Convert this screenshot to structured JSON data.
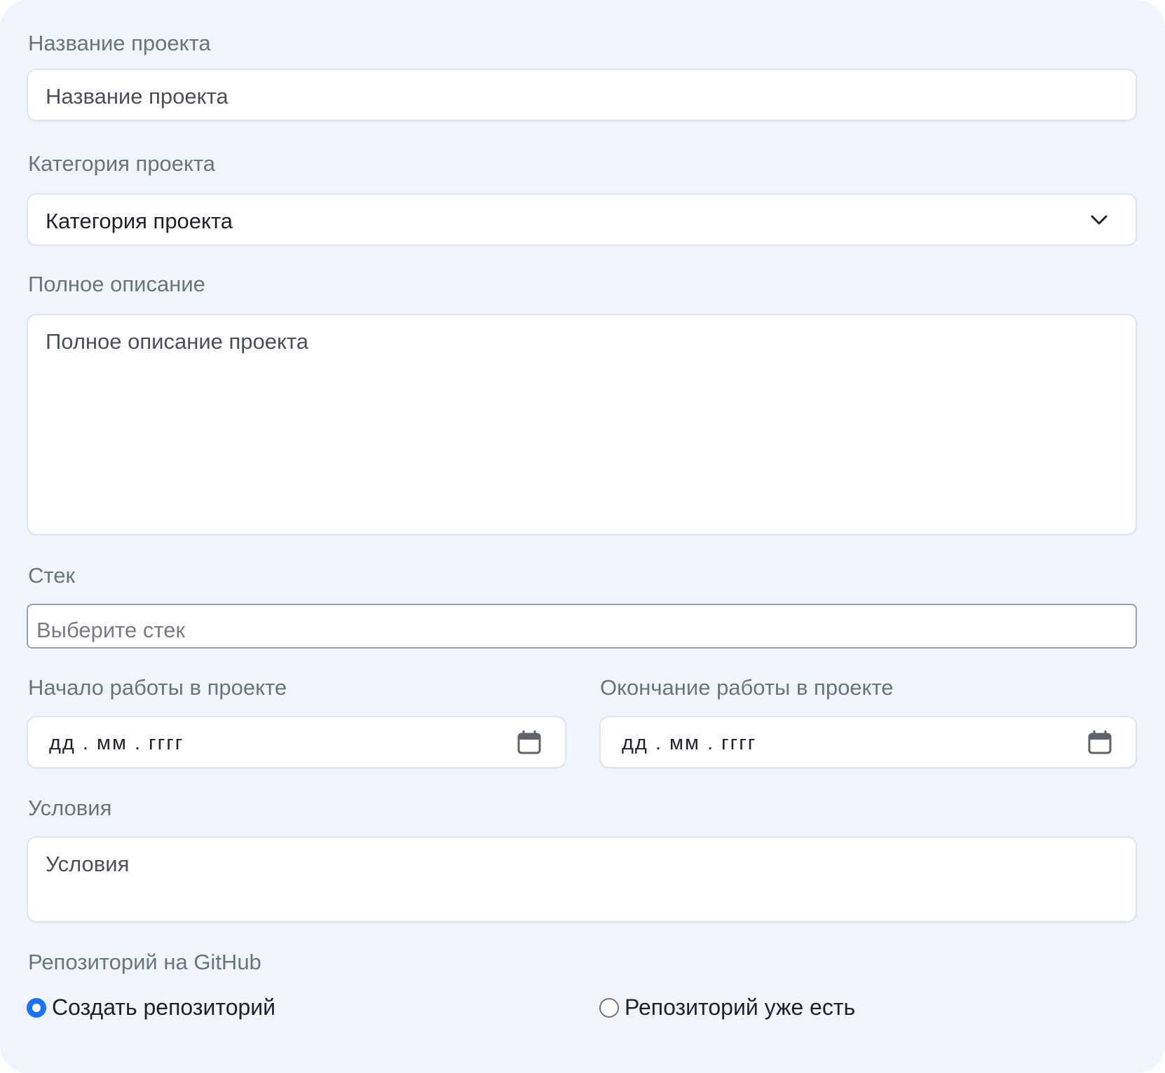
{
  "form": {
    "name": {
      "label": "Название проекта",
      "placeholder": "Название проекта"
    },
    "category": {
      "label": "Категория проекта",
      "selected": "Категория проекта"
    },
    "description": {
      "label": "Полное описание",
      "placeholder": "Полное описание проекта"
    },
    "stack": {
      "label": "Стек",
      "placeholder": "Выберите стек"
    },
    "start_date": {
      "label": "Начало работы в проекте",
      "placeholder": "дд . мм . гггг"
    },
    "end_date": {
      "label": "Окончание работы в проекте",
      "placeholder": "дд . мм . гггг"
    },
    "conditions": {
      "label": "Условия",
      "placeholder": "Условия"
    },
    "repository": {
      "label": "Репозиторий на GitHub",
      "options": [
        {
          "label": "Создать репозиторий",
          "checked": true
        },
        {
          "label": "Репозиторий уже есть",
          "checked": false
        }
      ]
    }
  },
  "colors": {
    "card_background": "#f0f5fd",
    "label_text": "#6c7280",
    "radio_accent": "#1a73f6"
  },
  "icons": [
    "chevron-down-icon",
    "calendar-icon"
  ]
}
